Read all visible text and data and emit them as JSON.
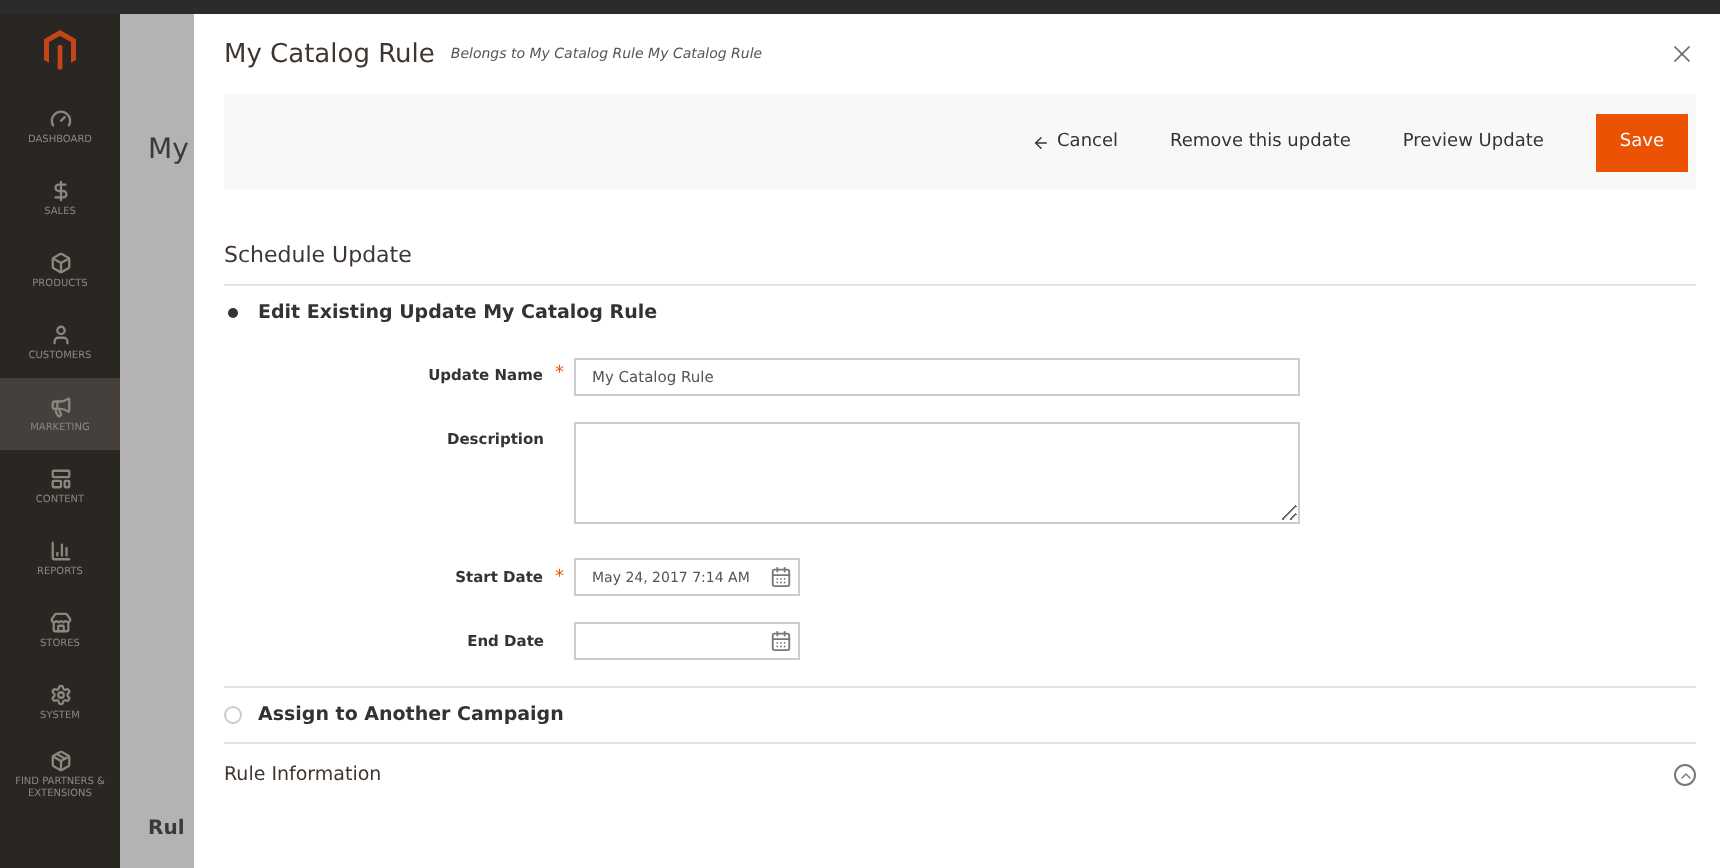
{
  "sidebar": {
    "items": [
      {
        "label": "DASHBOARD",
        "selected": false
      },
      {
        "label": "SALES",
        "selected": false
      },
      {
        "label": "PRODUCTS",
        "selected": false
      },
      {
        "label": "CUSTOMERS",
        "selected": false
      },
      {
        "label": "MARKETING",
        "selected": true
      },
      {
        "label": "CONTENT",
        "selected": false
      },
      {
        "label": "REPORTS",
        "selected": false
      },
      {
        "label": "STORES",
        "selected": false
      },
      {
        "label": "SYSTEM",
        "selected": false
      },
      {
        "label": "FIND PARTNERS & EXTENSIONS",
        "selected": false
      }
    ]
  },
  "background_page": {
    "title": "My",
    "section": "Rul"
  },
  "modal": {
    "title": "My Catalog Rule",
    "subtitle": "Belongs to My Catalog Rule My Catalog Rule",
    "actions": [
      {
        "kind": "back",
        "label": "Cancel"
      },
      {
        "kind": "link",
        "label": "Remove this update"
      },
      {
        "kind": "link",
        "label": "Preview Update"
      },
      {
        "kind": "primary",
        "label": "Save"
      }
    ],
    "section_title": "Schedule Update",
    "options": [
      {
        "label": "Edit Existing Update My Catalog Rule",
        "selected": true,
        "fields": [
          {
            "kind": "text",
            "label": "Update Name",
            "required_mark": "*",
            "value": "My Catalog Rule"
          },
          {
            "kind": "textarea",
            "label": "Description"
          },
          {
            "kind": "date",
            "label": "Start Date",
            "required_mark": "*",
            "value": "May 24, 2017 7:14 AM"
          },
          {
            "kind": "date",
            "label": "End Date"
          }
        ]
      },
      {
        "label": "Assign to Another Campaign",
        "selected": false
      }
    ],
    "collapsible": {
      "label": "Rule Information",
      "expanded": true
    }
  }
}
